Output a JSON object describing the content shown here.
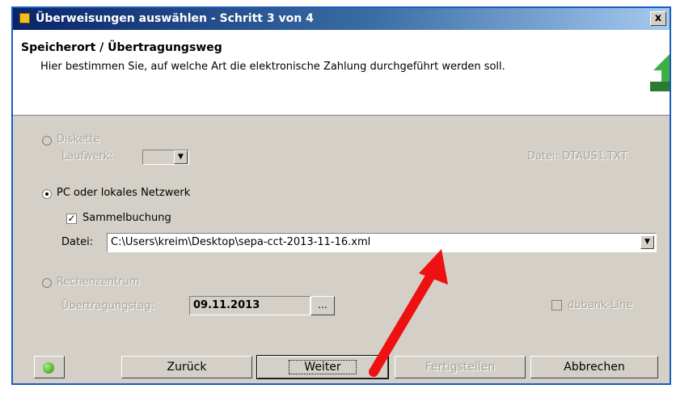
{
  "window": {
    "title": "Überweisungen auswählen - Schritt 3 von 4",
    "close_label": "x"
  },
  "header": {
    "title": "Speicherort / Übertragungsweg",
    "subtitle": "Hier bestimmen Sie, auf welche Art die elektronische Zahlung durchgeführt werden soll."
  },
  "diskette": {
    "label": "Diskette",
    "drive_label": "Laufwerk:",
    "drive_value": "",
    "file_info": "Datei: DTAUS1.TXT",
    "selected": false,
    "enabled": false
  },
  "pc": {
    "label": "PC oder lokales Netzwerk",
    "selected": true,
    "sammelbuchung_label": "Sammelbuchung",
    "sammelbuchung_checked": true,
    "file_label": "Datei:",
    "file_value": "C:\\Users\\kreim\\Desktop\\sepa-cct-2013-11-16.xml"
  },
  "rechenzentrum": {
    "label": "Rechenzentrum",
    "selected": false,
    "enabled": false,
    "date_label": "Übertragungstag:",
    "date_value": "09.11.2013",
    "date_button": "...",
    "dbbank_label": "dbbank-Line",
    "dbbank_checked": false
  },
  "buttons": {
    "back": "Zurück",
    "next": "Weiter",
    "finish": "Fertigstellen",
    "cancel": "Abbrechen"
  },
  "colors": {
    "annotation_arrow": "#ee1111",
    "title_bar": "#0a246a",
    "dialog_bg": "#d4d0c8"
  }
}
